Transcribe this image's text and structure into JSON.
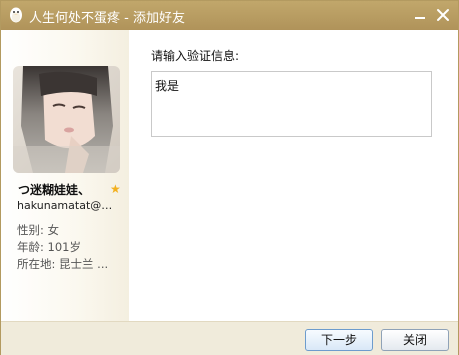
{
  "window": {
    "title": "人生何处不蛋疼 - 添加好友",
    "icons": {
      "app": "qq-penguin-icon",
      "minimize": "minimize-icon",
      "close": "close-icon"
    }
  },
  "profile": {
    "nickname": "つ迷糊娃娃、",
    "badge": "star-icon",
    "email": "hakunamatat@16...",
    "gender": "性别: 女",
    "age": "年龄: 101岁",
    "location": "所在地: 昆士兰 ..."
  },
  "form": {
    "prompt_label": "请输入验证信息:",
    "message_value": "我是"
  },
  "footer": {
    "next_label": "下一步",
    "close_label": "关闭"
  },
  "colors": {
    "titlebar": "#b89c5f",
    "footer": "#f0ebdb",
    "star": "#f2b01e",
    "button_border": "#8fa2b7"
  }
}
